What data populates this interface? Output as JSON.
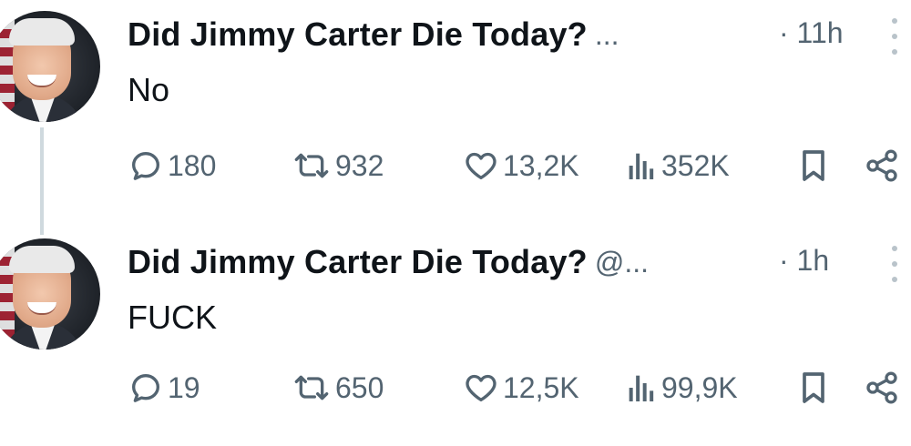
{
  "tweets": [
    {
      "name": "Did Jimmy Carter Die Today?",
      "handle": "...",
      "time": "· 11h",
      "text": "No",
      "stats": {
        "replies": "180",
        "retweets": "932",
        "likes": "13,2K",
        "views": "352K"
      }
    },
    {
      "name": "Did Jimmy Carter Die Today?",
      "handle": "@...",
      "time": "· 1h",
      "text": "FUCK",
      "stats": {
        "replies": "19",
        "retweets": "650",
        "likes": "12,5K",
        "views": "99,9K"
      }
    }
  ],
  "colors": {
    "text": "#0f1419",
    "muted": "#536471",
    "thread_line": "#cfd9de"
  },
  "icons": [
    "reply-icon",
    "retweet-icon",
    "like-icon",
    "views-icon",
    "bookmark-icon",
    "share-icon",
    "more-icon"
  ]
}
